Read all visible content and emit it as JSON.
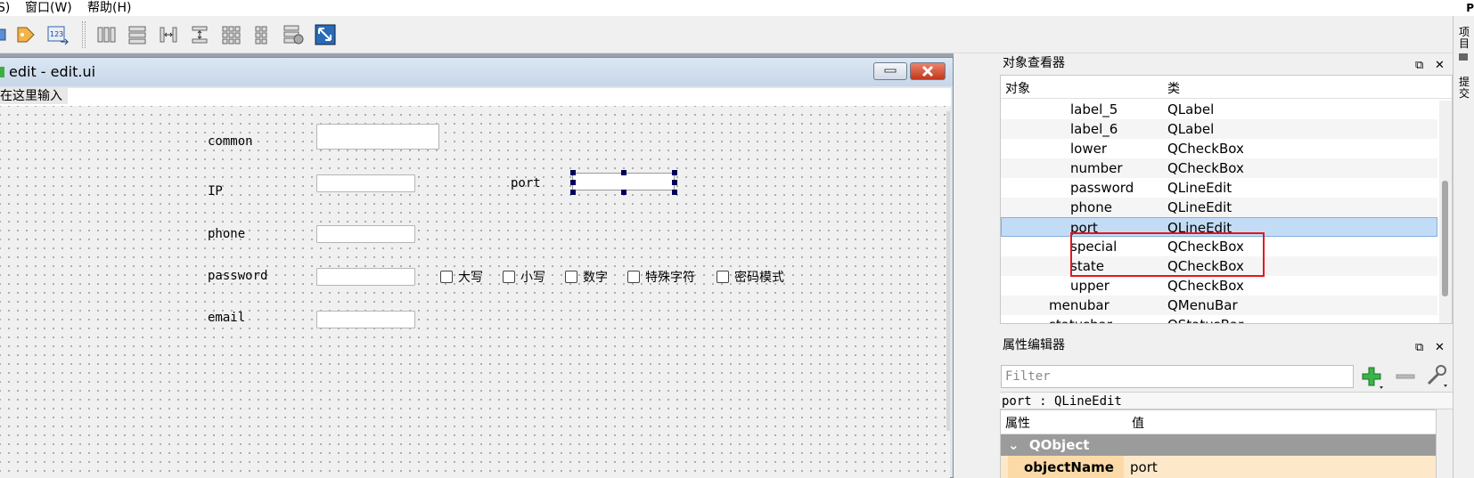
{
  "menubar": {
    "items": [
      "S)",
      "窗口(W)",
      "帮助(H)"
    ],
    "corner": "P"
  },
  "toolbar": {
    "icons": [
      "edit-tab-order-icon",
      "edit-buddies-icon",
      "edit-signals-icon",
      "layout-horizontal-icon",
      "layout-vertical-icon",
      "split-horizontal-icon",
      "split-vertical-icon",
      "layout-grid-icon",
      "layout-form-icon",
      "break-layout-icon",
      "adjust-size-icon"
    ]
  },
  "form_window": {
    "title": "edit - edit.ui",
    "menu_placeholder": "在这里输入",
    "labels": {
      "common": "common",
      "ip": "IP",
      "port": "port",
      "phone": "phone",
      "password": "password",
      "email": "email"
    },
    "checkboxes": [
      "大写",
      "小写",
      "数字",
      "特殊字符",
      "密码模式"
    ]
  },
  "object_inspector": {
    "title": "对象查看器",
    "header": {
      "object": "对象",
      "class": "类"
    },
    "rows": [
      {
        "name": "label_5",
        "class": "QLabel"
      },
      {
        "name": "label_6",
        "class": "QLabel"
      },
      {
        "name": "lower",
        "class": "QCheckBox"
      },
      {
        "name": "number",
        "class": "QCheckBox"
      },
      {
        "name": "password",
        "class": "QLineEdit"
      },
      {
        "name": "phone",
        "class": "QLineEdit"
      },
      {
        "name": "port",
        "class": "QLineEdit",
        "selected": true
      },
      {
        "name": "special",
        "class": "QCheckBox"
      },
      {
        "name": "state",
        "class": "QCheckBox"
      },
      {
        "name": "upper",
        "class": "QCheckBox"
      },
      {
        "name": "menubar",
        "class": "QMenuBar"
      },
      {
        "name": "statusbar",
        "class": "QStatusBar"
      }
    ]
  },
  "property_editor": {
    "title": "属性编辑器",
    "filter_placeholder": "Filter",
    "object_class": "port : QLineEdit",
    "header": {
      "property": "属性",
      "value": "值"
    },
    "group": "QObject",
    "object_name_key": "objectName",
    "object_name_value": "port"
  },
  "side_tabs": [
    "项目",
    "提交"
  ],
  "colors": {
    "selection": "#c3dcf5",
    "highlight_box": "#e8141e",
    "group_bg": "#9b9b9b",
    "prop_row": "#fde9c9"
  }
}
